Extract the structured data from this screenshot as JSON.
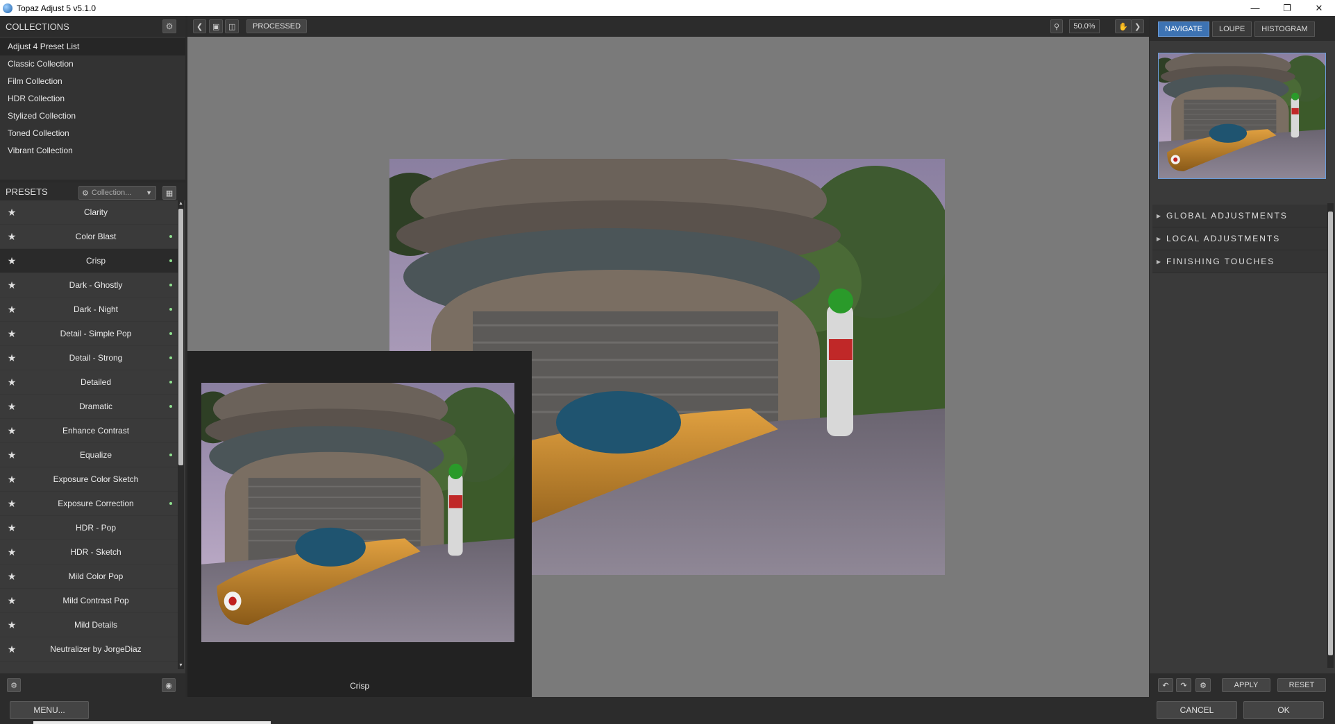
{
  "window": {
    "title": "Topaz Adjust 5 v5.1.0"
  },
  "collections": {
    "header": "COLLECTIONS",
    "items": [
      "Adjust 4 Preset List",
      "Classic Collection",
      "Film Collection",
      "HDR Collection",
      "Stylized Collection",
      "Toned Collection",
      "Vibrant Collection"
    ]
  },
  "presets": {
    "header": "PRESETS",
    "collection_select": "Collection...",
    "items": [
      {
        "name": "Clarity"
      },
      {
        "name": "Color Blast"
      },
      {
        "name": "Crisp"
      },
      {
        "name": "Dark - Ghostly"
      },
      {
        "name": "Dark - Night"
      },
      {
        "name": "Detail - Simple Pop"
      },
      {
        "name": "Detail - Strong"
      },
      {
        "name": "Detailed"
      },
      {
        "name": "Dramatic"
      },
      {
        "name": "Enhance Contrast"
      },
      {
        "name": "Equalize"
      },
      {
        "name": "Exposure Color Sketch"
      },
      {
        "name": "Exposure Correction"
      },
      {
        "name": "HDR - Pop"
      },
      {
        "name": "HDR - Sketch"
      },
      {
        "name": "Mild Color Pop"
      },
      {
        "name": "Mild Contrast Pop"
      },
      {
        "name": "Mild Details"
      },
      {
        "name": "Neutralizer by JorgeDiaz"
      }
    ]
  },
  "toolbar": {
    "processed_label": "PROCESSED",
    "zoom": "50.0%"
  },
  "preview": {
    "selected_preset_label": "Crisp"
  },
  "right": {
    "tabs": [
      "NAVIGATE",
      "LOUPE",
      "HISTOGRAM"
    ],
    "sections": [
      "GLOBAL ADJUSTMENTS",
      "LOCAL ADJUSTMENTS",
      "FINISHING TOUCHES"
    ],
    "apply_label": "APPLY",
    "reset_label": "RESET"
  },
  "bottom": {
    "menu_label": "MENU...",
    "cancel_label": "CANCEL",
    "ok_label": "OK"
  },
  "colors": {
    "accent": "#3d73b3",
    "preset_dot": "#8fe08f"
  }
}
